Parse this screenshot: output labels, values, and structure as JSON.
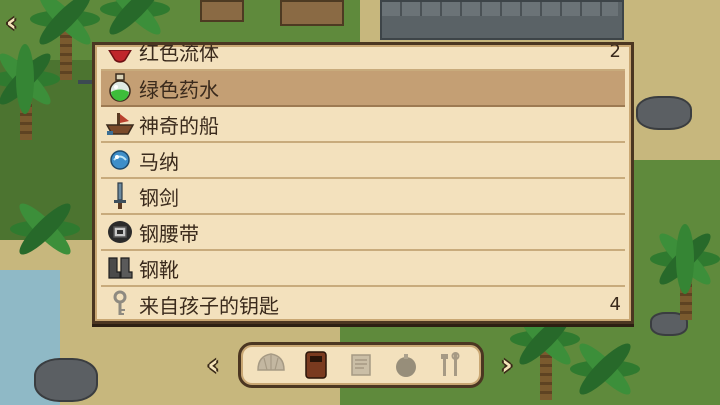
{
  "navigation": {
    "back_label": "‹",
    "prev_label": "‹",
    "next_label": "›"
  },
  "inventory": {
    "items": [
      {
        "name": "红色流体",
        "qty": "2",
        "icon": "red-fluid-icon"
      },
      {
        "name": "绿色药水",
        "qty": "",
        "icon": "green-potion-icon",
        "selected": true
      },
      {
        "name": "神奇的船",
        "qty": "",
        "icon": "magic-boat-icon"
      },
      {
        "name": "马纳",
        "qty": "",
        "icon": "mana-orb-icon"
      },
      {
        "name": "钢剑",
        "qty": "",
        "icon": "steel-sword-icon"
      },
      {
        "name": "钢腰带",
        "qty": "",
        "icon": "steel-belt-icon"
      },
      {
        "name": "钢靴",
        "qty": "",
        "icon": "steel-boots-icon"
      },
      {
        "name": "来自孩子的钥匙",
        "qty": "4",
        "icon": "key-icon"
      }
    ]
  },
  "categories": [
    {
      "icon": "shell-icon",
      "active": false
    },
    {
      "icon": "armor-icon",
      "active": true
    },
    {
      "icon": "scroll-icon",
      "active": false
    },
    {
      "icon": "bomb-icon",
      "active": false
    },
    {
      "icon": "tools-icon",
      "active": false
    }
  ],
  "colors": {
    "panel_bg": "#f3e1bd",
    "panel_border": "#4b3621",
    "selected_row": "#c49f74",
    "text": "#3a2a1c"
  }
}
